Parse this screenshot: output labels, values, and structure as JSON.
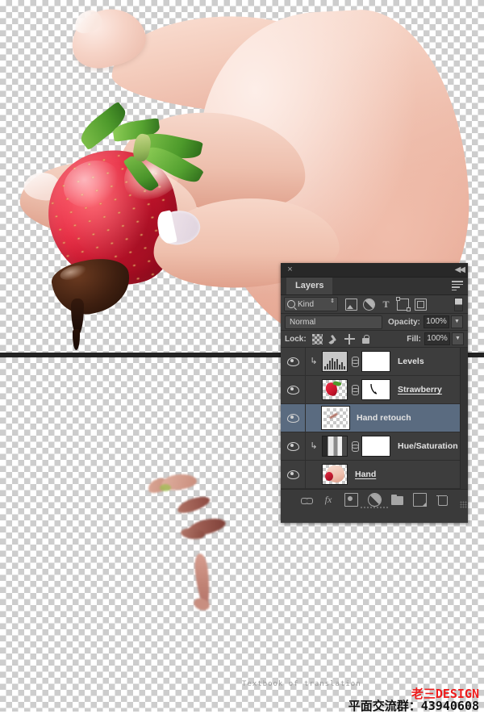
{
  "canvas": {
    "artwork_description": "hand-holding-chocolate-dipped-strawberry",
    "retouch_fragments_description": "skin-tone-retouch-brush-strokes"
  },
  "watermark": {
    "left_text": "Textbook of translation",
    "brand": "老三DESIGN",
    "qq_line": "平面交流群：43940608",
    "brand_color": "#ee1b1b",
    "qq_color": "#111111"
  },
  "panel": {
    "close_icon": "×",
    "collapse_icon": "◀◀",
    "tab_label": "Layers",
    "menu_icon": "panel-menu-icon"
  },
  "filter": {
    "kind_label": "Kind",
    "search_icon": "search-icon",
    "spinner_icon": "⇕",
    "icons": [
      {
        "name": "filter-pixel-layers-icon",
        "glyph": ""
      },
      {
        "name": "filter-adjustment-layers-icon",
        "glyph": ""
      },
      {
        "name": "filter-type-layers-icon",
        "glyph": "T"
      },
      {
        "name": "filter-shape-layers-icon",
        "glyph": ""
      },
      {
        "name": "filter-smart-object-layers-icon",
        "glyph": ""
      }
    ],
    "toggle_name": "filter-enable-toggle"
  },
  "blend": {
    "mode": "Normal",
    "opacity_label": "Opacity:",
    "opacity_value": "100%",
    "fill_label": "Fill:",
    "fill_value": "100%",
    "lock_label": "Lock:",
    "lock_icons": [
      {
        "name": "lock-transparent-pixels-icon"
      },
      {
        "name": "lock-image-pixels-icon"
      },
      {
        "name": "lock-position-icon"
      },
      {
        "name": "lock-all-icon"
      }
    ]
  },
  "layers": [
    {
      "name": "Levels",
      "visible": true,
      "selected": false,
      "clipped": true,
      "thumb": "histogram",
      "has_link": true,
      "mask": "white",
      "underlined": false
    },
    {
      "name": "Strawberry",
      "visible": true,
      "selected": false,
      "clipped": false,
      "thumb": "strawberry",
      "has_link": true,
      "mask": "vector-path",
      "underlined": true
    },
    {
      "name": "Hand retouch",
      "visible": true,
      "selected": true,
      "clipped": false,
      "thumb": "retouch",
      "has_link": false,
      "mask": "none",
      "underlined": false
    },
    {
      "name": "Hue/Saturation",
      "visible": true,
      "selected": false,
      "clipped": true,
      "thumb": "gradient",
      "has_link": true,
      "mask": "white",
      "underlined": false
    },
    {
      "name": "Hand",
      "visible": true,
      "selected": false,
      "clipped": false,
      "thumb": "hand",
      "has_link": false,
      "mask": "none",
      "underlined": true
    }
  ],
  "bottom_buttons": [
    {
      "name": "link-layers-button"
    },
    {
      "name": "layer-style-fx-button",
      "glyph": "fx"
    },
    {
      "name": "add-layer-mask-button"
    },
    {
      "name": "new-adjustment-layer-button"
    },
    {
      "name": "new-group-button"
    },
    {
      "name": "new-layer-button"
    },
    {
      "name": "delete-layer-button"
    }
  ],
  "colors": {
    "panel_bg": "#3a3a3a",
    "titlebar_bg": "#282828",
    "tab_active_bg": "#444444",
    "row_bg": "#3d3d3d",
    "row_selected_bg": "#5a6b80",
    "text": "#e2e2e2"
  }
}
